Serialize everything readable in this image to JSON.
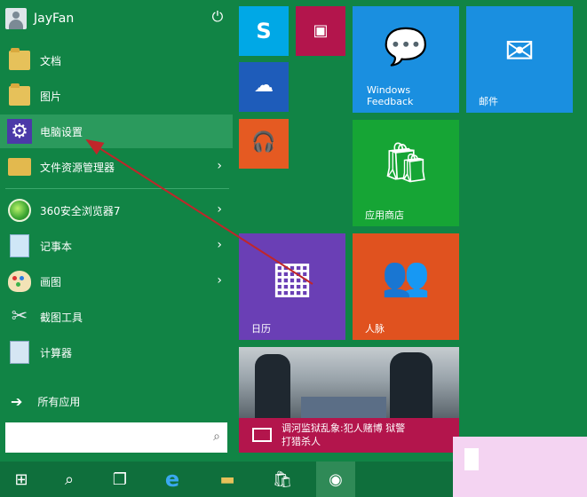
{
  "user": {
    "name": "JayFan"
  },
  "pinned": [
    {
      "label": "文档",
      "icon": "folder-icon"
    },
    {
      "label": "图片",
      "icon": "pictures-folder-icon"
    },
    {
      "label": "电脑设置",
      "icon": "gear-icon"
    },
    {
      "label": "文件资源管理器",
      "icon": "file-explorer-icon"
    }
  ],
  "recent": [
    {
      "label": "360安全浏览器7",
      "icon": "360-browser-icon"
    },
    {
      "label": "记事本",
      "icon": "notepad-icon"
    },
    {
      "label": "画图",
      "icon": "paint-icon"
    },
    {
      "label": "截图工具",
      "icon": "snipping-tool-icon"
    },
    {
      "label": "计算器",
      "icon": "calculator-icon"
    }
  ],
  "all_apps": {
    "label": "所有应用"
  },
  "search": {
    "placeholder": ""
  },
  "tiles": {
    "windows_feedback": "Windows\nFeedback",
    "mail": "邮件",
    "store": "应用商店",
    "calendar": "日历",
    "people": "人脉",
    "news_headline": "调河监狱乱象:犯人赌博 狱警",
    "news_headline2": "打猎杀人"
  },
  "colors": {
    "background": "#118445",
    "skype": "#00a8e6",
    "video": "#b3154c",
    "onedrive": "#1e5cba",
    "music": "#e55a22",
    "feedback": "#1a8fe0",
    "mail": "#1a8fe0",
    "store": "#16a535",
    "calendar": "#6a3fb5",
    "people": "#e0521f",
    "news_bar": "#b3154c"
  }
}
